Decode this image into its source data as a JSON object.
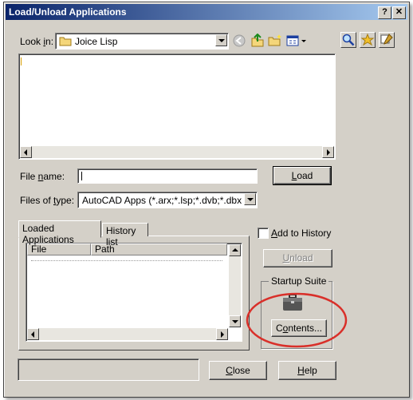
{
  "window": {
    "title": "Load/Unload Applications",
    "help_btn": "?",
    "close_btn": "✕"
  },
  "look_in": {
    "label_pre": "Look ",
    "label_key": "i",
    "label_post": "n:",
    "value": "Joice Lisp",
    "icon": "folder-icon"
  },
  "toolbar_icons": [
    "back-icon",
    "up-folder-icon",
    "new-folder-icon",
    "views-icon"
  ],
  "right_icons": [
    "search-icon",
    "favorites-icon",
    "tools-icon"
  ],
  "file_name": {
    "label_pre": "File ",
    "label_key": "n",
    "label_post": "ame:",
    "value": ""
  },
  "files_of_type": {
    "label_pre": "Files of ",
    "label_key": "t",
    "label_post": "ype:",
    "value": "AutoCAD Apps (*.arx;*.lsp;*.dvb;*.dbx;*.vlx;*.f"
  },
  "load_button": {
    "key": "L",
    "rest": "oad"
  },
  "tabs": [
    {
      "label": "Loaded Applications"
    },
    {
      "label": "History list"
    }
  ],
  "table": {
    "columns": [
      "File",
      "Path"
    ]
  },
  "add_to_history": {
    "key": "A",
    "rest": "dd to History",
    "checked": false
  },
  "unload_button": {
    "key": "U",
    "rest": "nload"
  },
  "startup_suite": {
    "title": "Startup Suite",
    "icon": "briefcase-icon",
    "button_pre": "C",
    "button_key": "o",
    "button_post": "ntents..."
  },
  "close_button": {
    "key": "C",
    "rest": "lose"
  },
  "help_button": {
    "key": "H",
    "rest": "elp"
  },
  "status": {
    "text": ""
  },
  "colors": {
    "titlebar_start": "#0a246a",
    "titlebar_end": "#a6caf0",
    "dialog_face": "#d4d0c8",
    "highlight_ellipse": "#d9302a"
  }
}
